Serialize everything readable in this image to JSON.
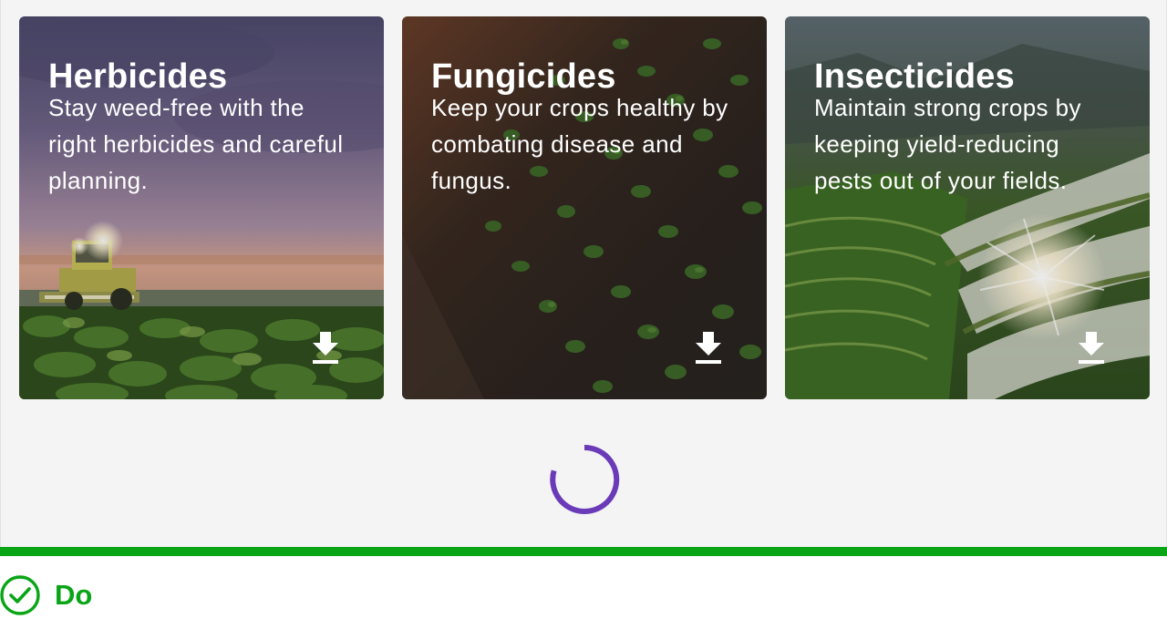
{
  "colors": {
    "stage_background": "#f4f4f4",
    "card_text": "#ffffff",
    "spinner": "#6a3ab8",
    "do_green": "#09a516"
  },
  "cards": [
    {
      "title": "Herbicides",
      "description": "Stay weed-free with the right herbicides and careful planning.",
      "scene": "harvester in soybean field at sunset",
      "icon": "download-icon"
    },
    {
      "title": "Fungicides",
      "description": "Keep your crops healthy by combating disease and fungus.",
      "scene": "aerial view of young crop rows on dark soil",
      "icon": "download-icon"
    },
    {
      "title": "Insecticides",
      "description": "Maintain strong crops by keeping yield-reducing pests out of your fields.",
      "scene": "terraced rice fields with sun glare",
      "icon": "download-icon"
    }
  ],
  "loading": {
    "icon": "loading-spinner-icon"
  },
  "guideline": {
    "label": "Do",
    "icon": "check-circle-icon"
  }
}
